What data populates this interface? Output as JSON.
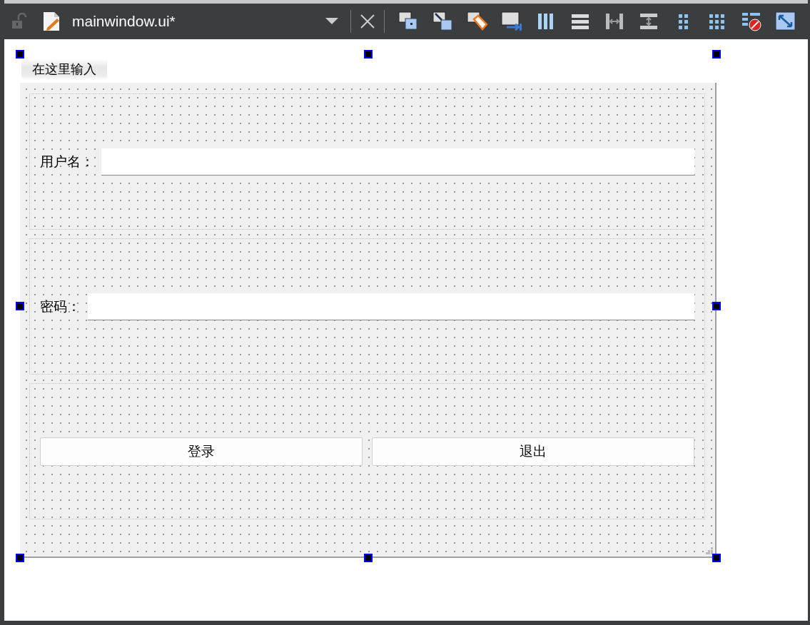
{
  "editor_tab": {
    "title": "mainwindow.ui*",
    "locked": false
  },
  "menu_bar": {
    "placeholder": "在这里输入"
  },
  "form": {
    "fields": [
      {
        "label": "用户名："
      },
      {
        "label": "密码："
      }
    ],
    "buttons": [
      "登录",
      "退出"
    ]
  }
}
